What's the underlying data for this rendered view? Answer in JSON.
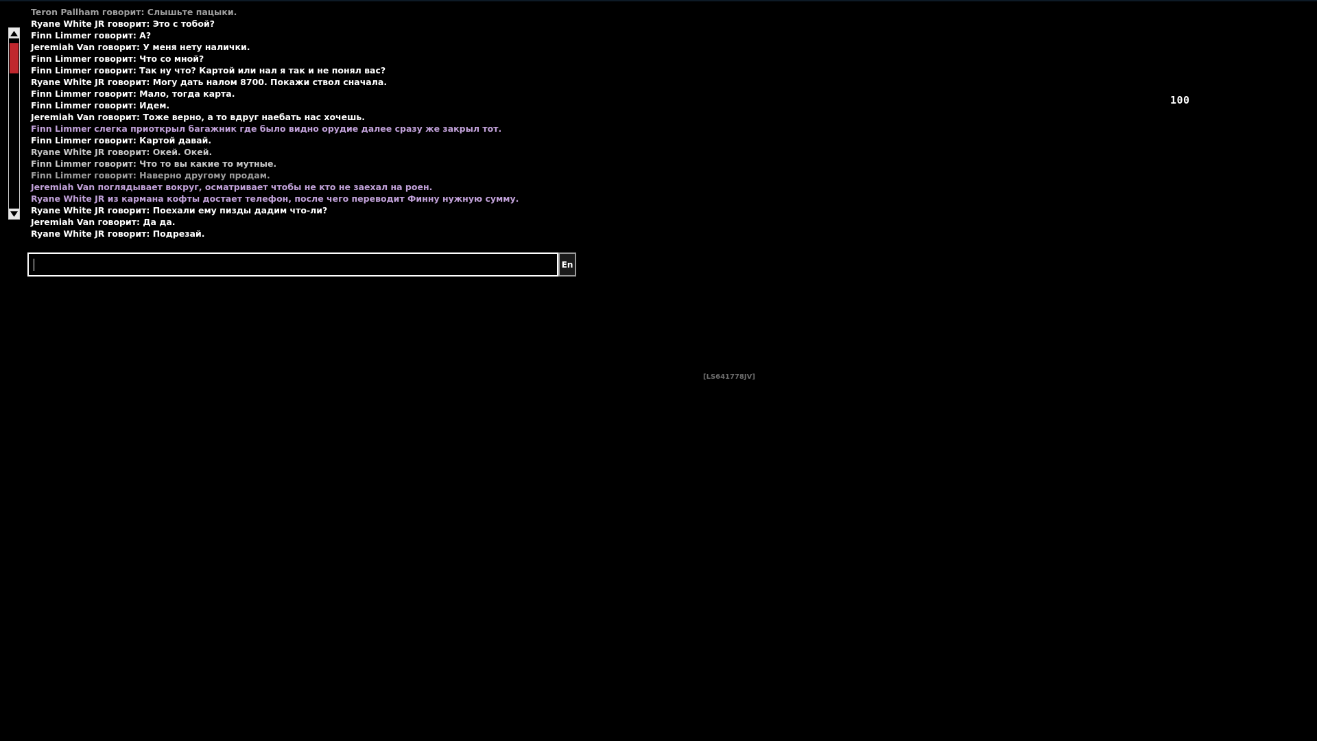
{
  "colors": {
    "say": "#ffffff",
    "say_faded": "#c8c8c8",
    "say_dim": "#a0a0a0",
    "action": "#c2a2da",
    "scroll_thumb": "#c0272d",
    "watermark": "#6e6e6e"
  },
  "chat": {
    "messages": [
      {
        "text": "Teron Pallham говорит: Слышьте пацыки.",
        "color": "#a0a0a0"
      },
      {
        "text": "Ryane White JR говорит: Это с тобой?",
        "color": "#ffffff"
      },
      {
        "text": "Finn Limmer говорит: А?",
        "color": "#ffffff"
      },
      {
        "text": "Jeremiah Van говорит: У меня нету налички.",
        "color": "#ffffff"
      },
      {
        "text": "Finn Limmer говорит: Что со мной?",
        "color": "#ffffff"
      },
      {
        "text": "Finn Limmer говорит: Так ну что? Картой или нал я так и не понял вас?",
        "color": "#ffffff"
      },
      {
        "text": "Ryane White JR говорит: Могу дать налом 8700. Покажи ствол сначала.",
        "color": "#ffffff"
      },
      {
        "text": "Finn Limmer говорит: Мало, тогда карта.",
        "color": "#ffffff"
      },
      {
        "text": "Finn Limmer говорит: Идем.",
        "color": "#ffffff"
      },
      {
        "text": "Jeremiah Van говорит: Тоже верно, а то вдруг наебать нас хочешь.",
        "color": "#ffffff"
      },
      {
        "text": "Finn Limmer слегка приоткрыл багажник где было видно орудие далее сразу же закрыл тот.",
        "color": "#c2a2da"
      },
      {
        "text": "Finn Limmer говорит: Картой давай.",
        "color": "#ffffff"
      },
      {
        "text": "Ryane White JR говорит: Окей. Окей.",
        "color": "#c8c8c8"
      },
      {
        "text": "Finn Limmer говорит: Что то вы какие то мутные.",
        "color": "#c8c8c8"
      },
      {
        "text": "Finn Limmer говорит: Наверно другому продам.",
        "color": "#a0a0a0"
      },
      {
        "text": "Jeremiah Van поглядывает вокруг, осматривает чтобы не кто не заехал на роен.",
        "color": "#c2a2da"
      },
      {
        "text": "Ryane White JR из кармана кофты достает телефон, после чего переводит Финну нужную сумму.",
        "color": "#c2a2da"
      },
      {
        "text": "Ryane White JR говорит: Поехали ему пизды дадим что-ли?",
        "color": "#ffffff"
      },
      {
        "text": "Jeremiah Van говорит: Да да.",
        "color": "#ffffff"
      },
      {
        "text": "Ryane White JR говорит: Подрезай.",
        "color": "#ffffff"
      }
    ],
    "input_value": "",
    "language_label": "En",
    "scroll_up_icon": "arrow-up-icon",
    "scroll_down_icon": "arrow-down-icon"
  },
  "hud": {
    "fps_value": "100",
    "watermark_text": "[LS641778JV]"
  }
}
